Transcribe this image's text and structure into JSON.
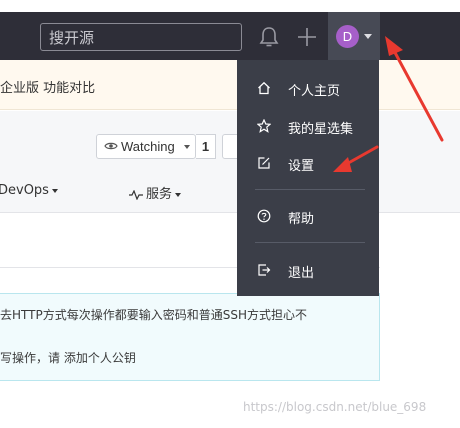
{
  "header": {
    "search_placeholder": "搜开源",
    "avatar_initial": "D"
  },
  "banner": {
    "text": "企业版 功能对比"
  },
  "repo": {
    "watch_label": "Watching",
    "watch_count": "1",
    "tabs": [
      {
        "label": "DevOps"
      },
      {
        "label": "服务"
      }
    ]
  },
  "notice": {
    "line1": "去HTTP方式每次操作都要输入密码和普通SSH方式担心不",
    "line2": "写操作，请 添加个人公钥"
  },
  "user_menu": {
    "items": [
      {
        "label": "个人主页",
        "icon": "home-icon"
      },
      {
        "label": "我的星选集",
        "icon": "star-icon"
      },
      {
        "label": "设置",
        "icon": "edit-icon"
      },
      {
        "label": "帮助",
        "icon": "help-icon"
      },
      {
        "label": "退出",
        "icon": "logout-icon"
      }
    ]
  },
  "watermark": "https://blog.csdn.net/blue_698",
  "colors": {
    "navbar": "#2e2e38",
    "menu_bg": "#3b3e48",
    "avatar": "#a65fc9",
    "annotation_arrow": "#e8392f",
    "banner_bg": "#fff9ef",
    "notice_bg": "#f1fbfd"
  }
}
